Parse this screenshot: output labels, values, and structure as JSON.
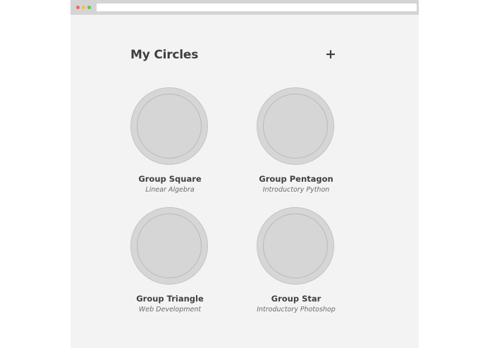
{
  "header": {
    "title": "My Circles",
    "add_label": "+"
  },
  "circles": [
    {
      "name": "Group Square",
      "subject": "Linear Algebra"
    },
    {
      "name": "Group Pentagon",
      "subject": "Introductory Python"
    },
    {
      "name": "Group Triangle",
      "subject": "Web Development"
    },
    {
      "name": "Group Star",
      "subject": "Introductory Photoshop"
    }
  ],
  "colors": {
    "window_bg": "#f3f3f3",
    "titlebar": "#d4d4d4",
    "circle_fill": "#d6d6d6",
    "text_dark": "#3f3f3f",
    "text_muted": "#6b6b6b",
    "dot_close": "#ec6a5e",
    "dot_minimize": "#f4bf4f",
    "dot_maximize": "#61c554"
  }
}
